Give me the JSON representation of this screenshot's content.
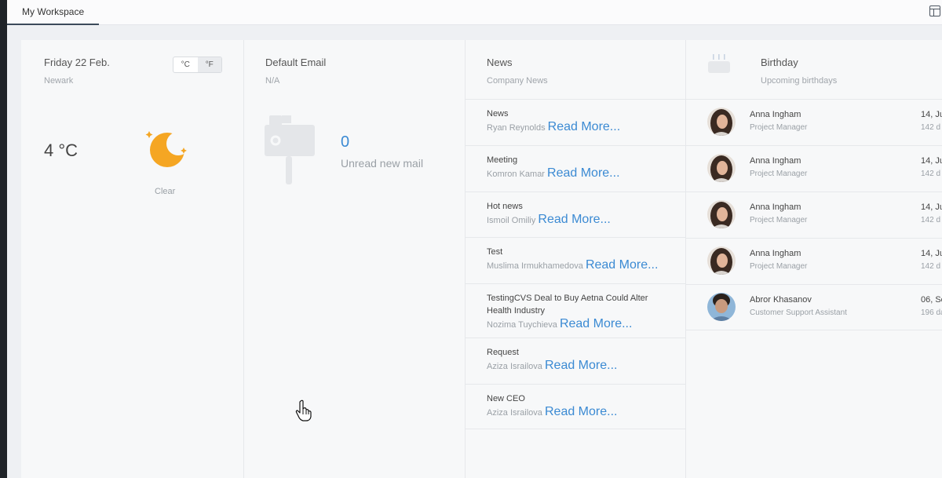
{
  "tabs": {
    "workspace": "My Workspace"
  },
  "weather": {
    "date": "Friday 22 Feb.",
    "city": "Newark",
    "unit_c": "°C",
    "unit_f": "°F",
    "active_unit": "°F",
    "temperature": "4 °C",
    "condition": "Clear",
    "icon": "moon-icon",
    "icon_color": "#f5a623"
  },
  "email": {
    "title": "Default Email",
    "subtitle": "N/A",
    "count": "0",
    "label": "Unread new mail",
    "icon": "mailbox-icon"
  },
  "news": {
    "title": "News",
    "subtitle": "Company News",
    "read_more": "Read More...",
    "items": [
      {
        "title": "News",
        "author": "Ryan Reynolds"
      },
      {
        "title": "Meeting",
        "author": "Komron Kamar"
      },
      {
        "title": "Hot news",
        "author": "Ismoil Omiliy"
      },
      {
        "title": "Test",
        "author": "Muslima Irmukhamedova"
      },
      {
        "title": "TestingCVS Deal to Buy Aetna Could Alter Health Industry",
        "author": "Nozima Tuychieva"
      },
      {
        "title": "Request",
        "author": "Aziza Israilova"
      },
      {
        "title": "New CEO",
        "author": "Aziza Israilova"
      }
    ]
  },
  "birthday": {
    "title": "Birthday",
    "subtitle": "Upcoming birthdays",
    "icon": "cake-icon",
    "items": [
      {
        "name": "Anna Ingham",
        "role": "Project Manager",
        "date": "14, Ju",
        "days": "142 d"
      },
      {
        "name": "Anna Ingham",
        "role": "Project Manager",
        "date": "14, Ju",
        "days": "142 d"
      },
      {
        "name": "Anna Ingham",
        "role": "Project Manager",
        "date": "14, Ju",
        "days": "142 d"
      },
      {
        "name": "Anna Ingham",
        "role": "Project Manager",
        "date": "14, Ju",
        "days": "142 d"
      },
      {
        "name": "Abror Khasanov",
        "role": "Customer Support Assistant",
        "date": "06, Se",
        "days": "196 da"
      }
    ]
  },
  "colors": {
    "accent": "#3b8ad3",
    "moon": "#f5a623"
  }
}
